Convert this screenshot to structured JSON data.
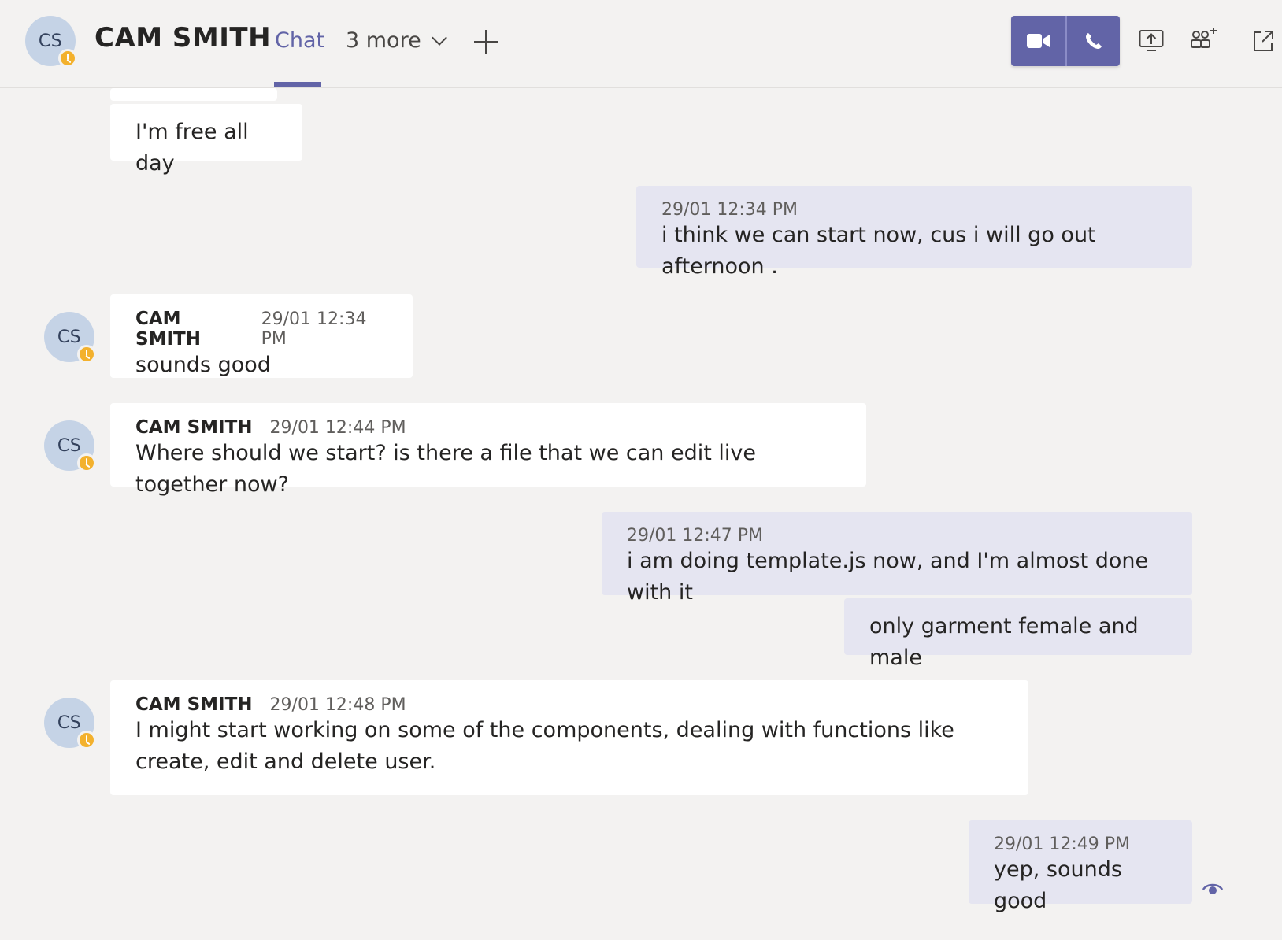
{
  "header": {
    "avatar_initials": "CS",
    "name": "CAM SMITH",
    "tab_chat": "Chat",
    "more_tabs": "3 more",
    "icons": [
      "video-call-icon",
      "audio-call-icon",
      "share-screen-icon",
      "add-people-icon",
      "pop-out-icon"
    ],
    "accent_color": "#6264a7"
  },
  "messages": [
    {
      "from": "them",
      "text": "I'm free all day"
    },
    {
      "from": "me",
      "time": "29/01 12:34 PM",
      "text": "i think we can start now, cus i will go out afternoon ."
    },
    {
      "from": "them",
      "author": "CAM SMITH",
      "initials": "CS",
      "time": "29/01 12:34 PM",
      "text": "sounds good"
    },
    {
      "from": "them",
      "author": "CAM SMITH",
      "initials": "CS",
      "time": "29/01 12:44 PM",
      "text": "Where should we start? is there a file that we can edit live together now?"
    },
    {
      "from": "me",
      "time": "29/01 12:47 PM",
      "text": "i am doing template.js now, and I'm almost done with it"
    },
    {
      "from": "me",
      "text": "only garment female and male"
    },
    {
      "from": "them",
      "author": "CAM SMITH",
      "initials": "CS",
      "time": "29/01 12:48 PM",
      "text": "I might start working on some of the components, dealing with functions like create, edit and delete user."
    },
    {
      "from": "me",
      "time": "29/01 12:49 PM",
      "text": "yep, sounds good"
    }
  ]
}
